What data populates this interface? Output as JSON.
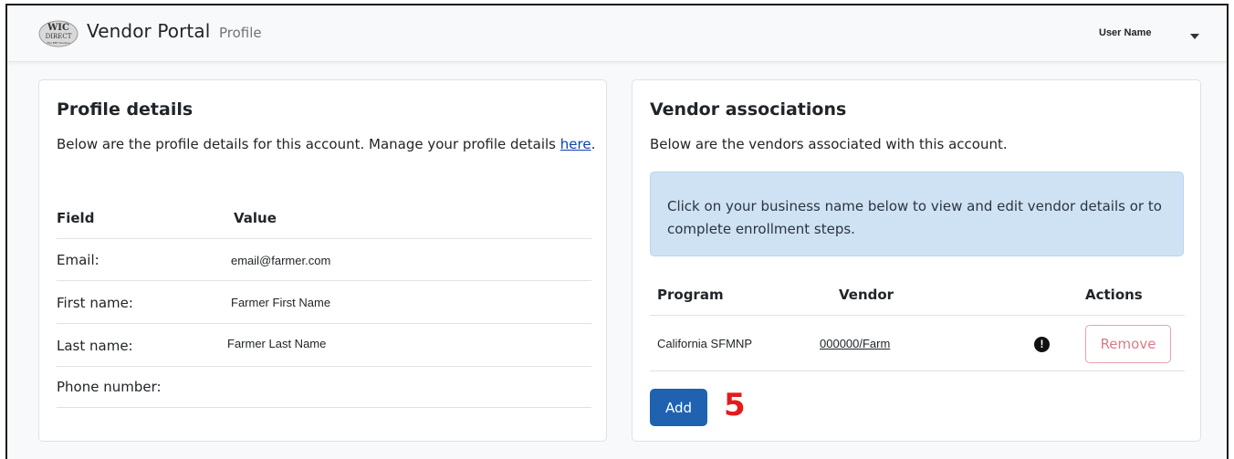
{
  "header": {
    "brand": "Vendor Portal",
    "page": "Profile",
    "user": "User Name",
    "logo_text": "WIC Direct"
  },
  "profile": {
    "title": "Profile details",
    "desc": "Below are the profile details for this account. Manage your profile details",
    "link": "here",
    "link_suffix": ".",
    "columns": [
      "Field",
      "Value"
    ],
    "rows": [
      {
        "field": "Email:",
        "value": "email@farmer.com"
      },
      {
        "field": "First name:",
        "value": "Farmer First Name"
      },
      {
        "field": "Last name:",
        "value": "Farmer Last Name"
      },
      {
        "field": "Phone number:",
        "value": ""
      }
    ]
  },
  "vendors": {
    "title": "Vendor associations",
    "desc": "Below are the vendors associated with this account.",
    "alert": "Click on your business name below to view and edit vendor details or to complete enrollment steps.",
    "columns": [
      "Program",
      "Vendor",
      "Actions"
    ],
    "rows": [
      {
        "program": "California SFMNP",
        "vendor": "000000/Farm",
        "status_icon": "!",
        "remove": "Remove"
      }
    ],
    "add_label": "Add",
    "step_marker": "5"
  },
  "colors": {
    "primary": "#1f62b0",
    "alert_bg": "#cfe2f3",
    "danger_outline": "#dc7b86",
    "step_marker": "#e31b1b"
  }
}
